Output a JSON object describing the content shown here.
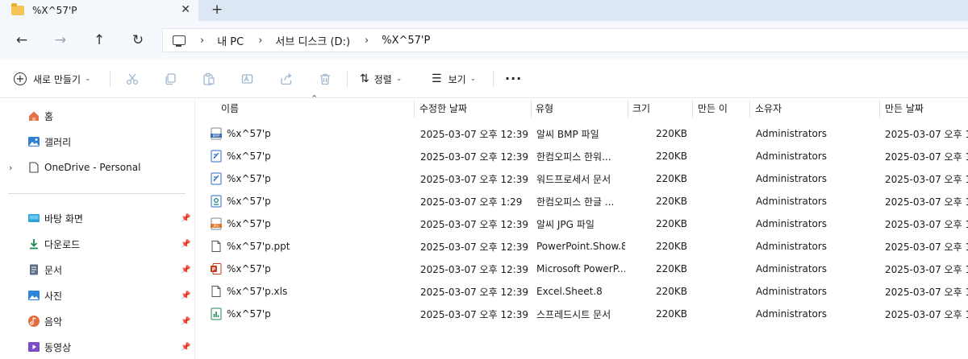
{
  "tab": {
    "title": "%X^57'P",
    "close": "✕",
    "new": "+"
  },
  "nav": {
    "back": "←",
    "forward": "→",
    "up": "↑",
    "refresh": "↻",
    "breadcrumbs": [
      "내 PC",
      "서브 디스크 (D:)",
      "%X^57'P"
    ],
    "separator": "›"
  },
  "commands": {
    "new_label": "새로 만들기",
    "sort_label": "정렬",
    "view_label": "보기",
    "more": "···",
    "icons": [
      "cut-icon",
      "copy-icon",
      "paste-icon",
      "rename-icon",
      "share-icon",
      "delete-icon"
    ]
  },
  "sidebar": {
    "top": [
      {
        "label": "홈",
        "icon": "home-icon"
      },
      {
        "label": "갤러리",
        "icon": "gallery-icon"
      },
      {
        "label": "OneDrive - Personal",
        "icon": "cloud-icon",
        "expander": "›"
      }
    ],
    "pinned": [
      {
        "label": "바탕 화면",
        "icon": "desktop-icon"
      },
      {
        "label": "다운로드",
        "icon": "download-icon"
      },
      {
        "label": "문서",
        "icon": "document-icon"
      },
      {
        "label": "사진",
        "icon": "pictures-icon"
      },
      {
        "label": "음악",
        "icon": "music-icon"
      },
      {
        "label": "동영상",
        "icon": "video-icon"
      }
    ],
    "pin_glyph": "📌"
  },
  "columns": [
    "이름",
    "수정한 날짜",
    "유형",
    "크기",
    "만든 이",
    "소유자",
    "만든 날짜"
  ],
  "files": [
    {
      "name": "%x^57'p",
      "modified": "2025-03-07 오후 12:39",
      "type": "알씨 BMP 파일",
      "size": "220KB",
      "owner": "Administrators",
      "created": "2025-03-07 오후 1",
      "icon": "bmp-icon"
    },
    {
      "name": "%x^57'p",
      "modified": "2025-03-07 오후 12:39",
      "type": "한컴오피스 한워...",
      "size": "220KB",
      "owner": "Administrators",
      "created": "2025-03-07 오후 1",
      "icon": "hwp-icon"
    },
    {
      "name": "%x^57'p",
      "modified": "2025-03-07 오후 12:39",
      "type": "워드프로세서 문서",
      "size": "220KB",
      "owner": "Administrators",
      "created": "2025-03-07 오후 1",
      "icon": "word-icon"
    },
    {
      "name": "%x^57'p",
      "modified": "2025-03-07 오후 1:29",
      "type": "한컴오피스 한글 ...",
      "size": "220KB",
      "owner": "Administrators",
      "created": "2025-03-07 오후 1",
      "icon": "hangul-icon"
    },
    {
      "name": "%x^57'p",
      "modified": "2025-03-07 오후 12:39",
      "type": "알씨 JPG 파일",
      "size": "220KB",
      "owner": "Administrators",
      "created": "2025-03-07 오후 1",
      "icon": "jpg-icon"
    },
    {
      "name": "%x^57'p.ppt",
      "modified": "2025-03-07 오후 12:39",
      "type": "PowerPoint.Show.8",
      "size": "220KB",
      "owner": "Administrators",
      "created": "2025-03-07 오후 1",
      "icon": "blank-file-icon"
    },
    {
      "name": "%x^57'p",
      "modified": "2025-03-07 오후 12:39",
      "type": "Microsoft PowerP...",
      "size": "220KB",
      "owner": "Administrators",
      "created": "2025-03-07 오후 1",
      "icon": "powerpoint-icon"
    },
    {
      "name": "%x^57'p.xls",
      "modified": "2025-03-07 오후 12:39",
      "type": "Excel.Sheet.8",
      "size": "220KB",
      "owner": "Administrators",
      "created": "2025-03-07 오후 1",
      "icon": "blank-file-icon"
    },
    {
      "name": "%x^57'p",
      "modified": "2025-03-07 오후 12:39",
      "type": "스프레드시트 문서",
      "size": "220KB",
      "owner": "Administrators",
      "created": "2025-03-07 오후 1",
      "icon": "spreadsheet-icon"
    }
  ]
}
